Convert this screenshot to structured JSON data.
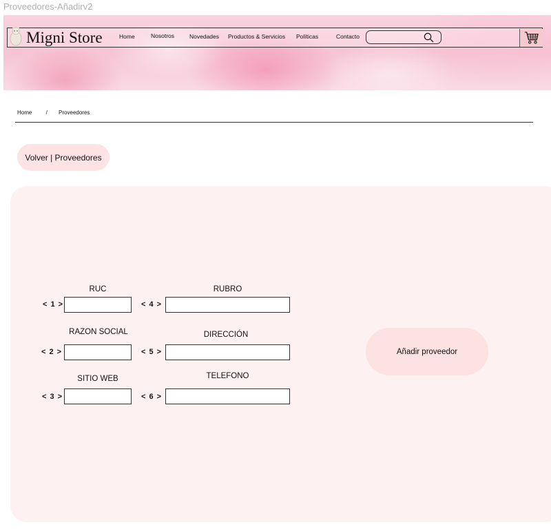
{
  "frame_title": "Proveedores-Añadirv2",
  "header": {
    "brand": "Migni Store",
    "nav": [
      "Home",
      "Nosotros",
      "Novedades",
      "Productos & Servicios",
      "Políticas",
      "Contacto"
    ],
    "search_value": "",
    "search_icon": "search-icon",
    "cart_icon": "cart-icon"
  },
  "breadcrumb": {
    "home": "Home",
    "separator": "/",
    "current": "Proveedores"
  },
  "back_button": {
    "label": "Volver | Proveedores"
  },
  "form": {
    "fields": [
      {
        "index": "< 1 >",
        "label": "RUC",
        "value": ""
      },
      {
        "index": "< 2 >",
        "label": "RAZON SOCIAL",
        "value": ""
      },
      {
        "index": "< 3 >",
        "label": "SITIO WEB",
        "value": ""
      },
      {
        "index": "< 4 >",
        "label": "RUBRO",
        "value": ""
      },
      {
        "index": "< 5 >",
        "label": "DIRECCIÓN",
        "value": ""
      },
      {
        "index": "< 6 >",
        "label": "TELEFONO",
        "value": ""
      }
    ],
    "submit_label": "Añadir proveedor"
  },
  "colors": {
    "pill_bg": "#fde3e4",
    "panel_bg": "#fef1f1",
    "cart_bg": "#f6c9cf"
  }
}
